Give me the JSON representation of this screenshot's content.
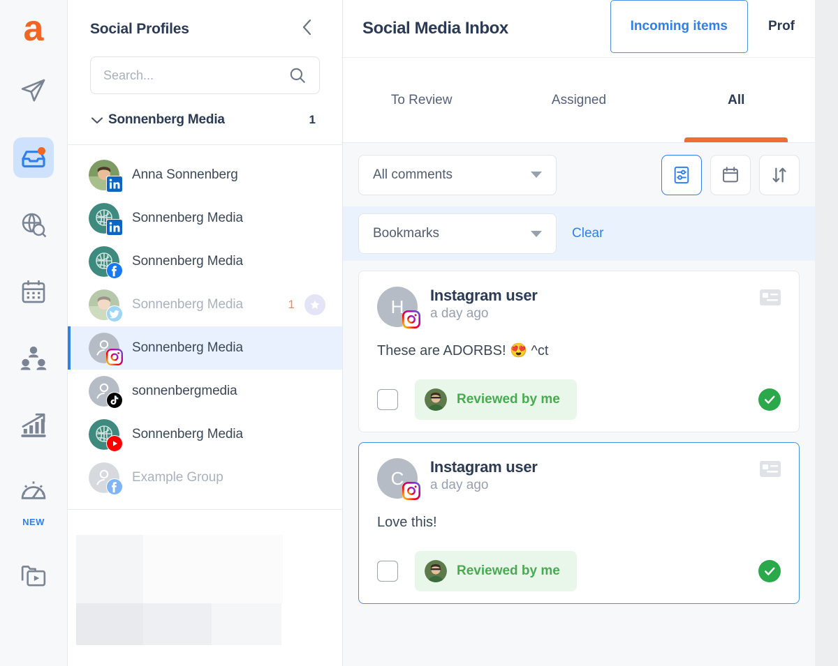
{
  "app": {
    "logo_letter": "a",
    "brand_color": "#f26522"
  },
  "rail": {
    "items": [
      {
        "name": "publish-icon",
        "label": "Publish"
      },
      {
        "name": "inbox-icon",
        "label": "Inbox",
        "active": true,
        "badge": true
      },
      {
        "name": "monitoring-icon",
        "label": "Monitoring"
      },
      {
        "name": "calendar-icon",
        "label": "Calendar"
      },
      {
        "name": "audience-icon",
        "label": "Audience"
      },
      {
        "name": "analytics-icon",
        "label": "Analytics"
      },
      {
        "name": "benchmark-icon",
        "label": "Benchmark",
        "tag": "NEW"
      },
      {
        "name": "asset-library-icon",
        "label": "Asset Library"
      }
    ],
    "new_tag": "NEW"
  },
  "sidebar": {
    "title": "Social Profiles",
    "collapse_icon": "chevron-left-icon",
    "search": {
      "value": "",
      "placeholder": "Search...",
      "icon": "search-icon"
    },
    "group": {
      "name": "Sonnenberg Media",
      "count": "1",
      "chevron": "chevron-down-icon"
    },
    "profiles": [
      {
        "name": "Anna Sonnenberg",
        "platform": "linkedin",
        "avatar": "photo",
        "muted": false,
        "selected": false
      },
      {
        "name": "Sonnenberg Media",
        "platform": "linkedin",
        "avatar": "logo",
        "muted": false,
        "selected": false
      },
      {
        "name": "Sonnenberg Media",
        "platform": "facebook",
        "avatar": "logo",
        "muted": false,
        "selected": false
      },
      {
        "name": "Sonnenberg Media",
        "platform": "twitter",
        "avatar": "photo",
        "muted": true,
        "selected": false,
        "count": "1",
        "starred": true
      },
      {
        "name": "Sonnenberg Media",
        "platform": "instagram",
        "avatar": "person",
        "muted": false,
        "selected": true
      },
      {
        "name": "sonnenbergmedia",
        "platform": "tiktok",
        "avatar": "person",
        "muted": false,
        "selected": false
      },
      {
        "name": "Sonnenberg Media",
        "platform": "youtube",
        "avatar": "logo",
        "muted": false,
        "selected": false
      },
      {
        "name": "Example Group",
        "platform": "facebook",
        "avatar": "person",
        "muted": true,
        "selected": false
      }
    ]
  },
  "main": {
    "title": "Social Media Inbox",
    "header_tabs": [
      {
        "label": "Incoming items",
        "active": true
      },
      {
        "label": "Prof",
        "active": false
      }
    ],
    "sub_tabs": [
      {
        "label": "To Review",
        "active": false
      },
      {
        "label": "Assigned",
        "active": false
      },
      {
        "label": "All",
        "active": true
      }
    ],
    "filters": {
      "comments_dropdown": {
        "value": "All comments",
        "icon": "chevron-down-icon"
      },
      "bookmarks_dropdown": {
        "value": "Bookmarks",
        "icon": "chevron-down-icon"
      },
      "clear_label": "Clear",
      "icon_buttons": [
        {
          "name": "filter-settings-icon",
          "active": true
        },
        {
          "name": "calendar-icon",
          "active": false
        },
        {
          "name": "sort-icon",
          "active": false
        }
      ]
    },
    "cards": [
      {
        "avatar_letter": "H",
        "platform": "instagram",
        "user": "Instagram user",
        "time": "a day ago",
        "text": "These are ADORBS! 😍 ^ct",
        "corner_icon": "contact-card-icon",
        "checkbox_checked": false,
        "chip_label": "Reviewed by me",
        "status_icon": "check-circle-icon",
        "selected": false
      },
      {
        "avatar_letter": "C",
        "platform": "instagram",
        "user": "Instagram user",
        "time": "a day ago",
        "text": "Love this!",
        "corner_icon": "contact-card-icon",
        "checkbox_checked": false,
        "chip_label": "Reviewed by me",
        "status_icon": "check-circle-icon",
        "selected": true
      }
    ]
  },
  "colors": {
    "accent_orange": "#ef6c33",
    "accent_blue": "#2f80ed",
    "green": "#2aa84a",
    "selected_row_bg": "#e8f1fd"
  }
}
